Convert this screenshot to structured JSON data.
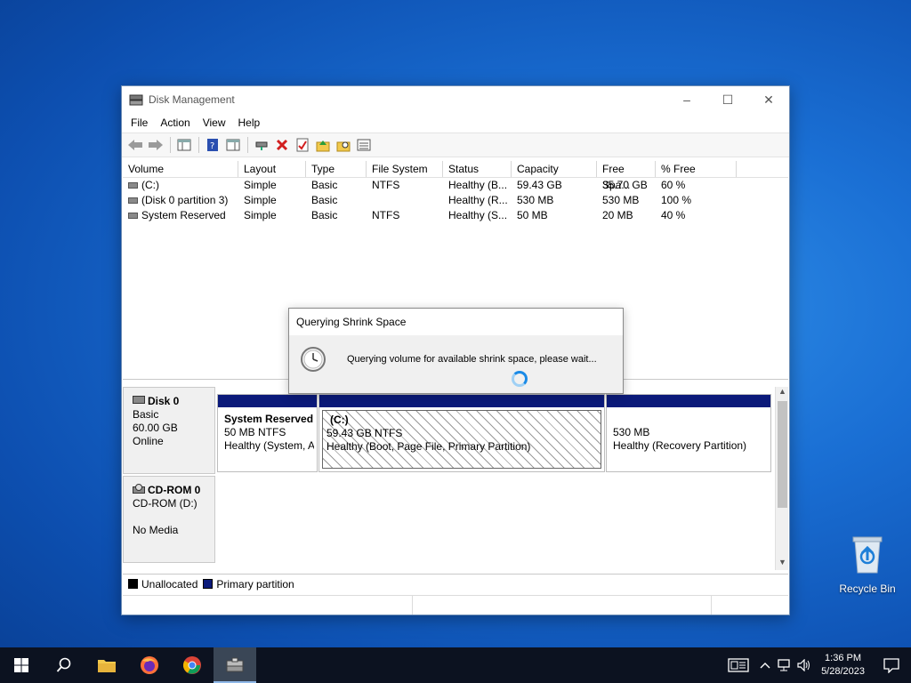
{
  "window": {
    "title": "Disk Management",
    "minimize": "–",
    "maximize": "☐",
    "close": "✕"
  },
  "menu": [
    "File",
    "Action",
    "View",
    "Help"
  ],
  "volume_table": {
    "headers": [
      "Volume",
      "Layout",
      "Type",
      "File System",
      "Status",
      "Capacity",
      "Free Spa...",
      "% Free"
    ],
    "rows": [
      {
        "volume": "(C:)",
        "layout": "Simple",
        "type": "Basic",
        "fs": "NTFS",
        "status": "Healthy (B...",
        "capacity": "59.43 GB",
        "free": "35.70 GB",
        "pct": "60 %"
      },
      {
        "volume": "(Disk 0 partition 3)",
        "layout": "Simple",
        "type": "Basic",
        "fs": "",
        "status": "Healthy (R...",
        "capacity": "530 MB",
        "free": "530 MB",
        "pct": "100 %"
      },
      {
        "volume": "System Reserved",
        "layout": "Simple",
        "type": "Basic",
        "fs": "NTFS",
        "status": "Healthy (S...",
        "capacity": "50 MB",
        "free": "20 MB",
        "pct": "40 %"
      }
    ]
  },
  "disk0": {
    "name": "Disk 0",
    "type": "Basic",
    "size": "60.00 GB",
    "state": "Online",
    "partitions": [
      {
        "title": "System Reserved",
        "line1": "50 MB NTFS",
        "line2": "Healthy (System, A"
      },
      {
        "title": "(C:)",
        "line1": "59.43 GB NTFS",
        "line2": "Healthy (Boot, Page File, Primary Partition)"
      },
      {
        "title": "",
        "line1": "530 MB",
        "line2": "Healthy (Recovery Partition)"
      }
    ]
  },
  "cdrom0": {
    "name": "CD-ROM 0",
    "drive": "CD-ROM (D:)",
    "media": "No Media"
  },
  "legend": {
    "unallocated": "Unallocated",
    "primary": "Primary partition",
    "unallocated_color": "#000000",
    "primary_color": "#0b1a7a"
  },
  "dialog": {
    "title": "Querying Shrink Space",
    "message": "Querying volume for available shrink space, please wait..."
  },
  "desktop": {
    "recycle_bin": "Recycle Bin"
  },
  "taskbar": {
    "time": "1:36 PM",
    "date": "5/28/2023"
  }
}
